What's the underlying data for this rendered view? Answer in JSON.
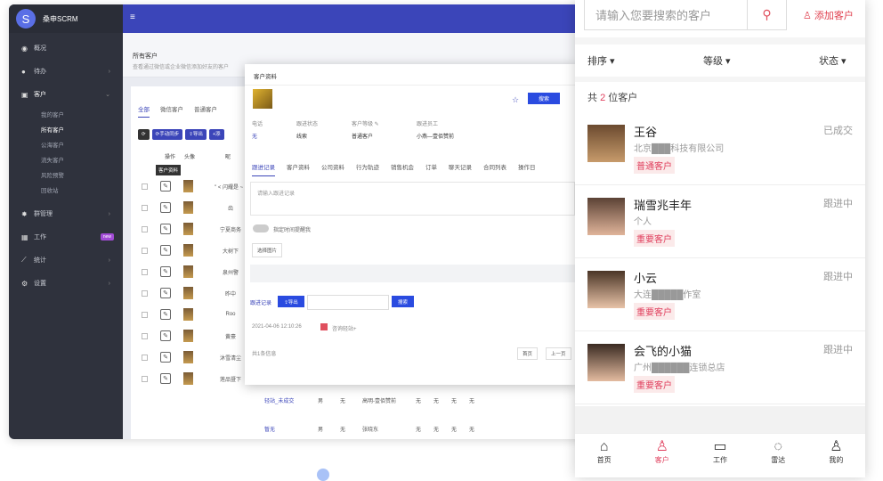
{
  "app": {
    "brand": "桑申SCRM",
    "menu_icon": "≡",
    "logo_glyph": "S"
  },
  "sidebar": {
    "items": [
      {
        "icon": "◉",
        "label": "概况",
        "arrow": ""
      },
      {
        "icon": "●",
        "label": "待办",
        "arrow": "›"
      },
      {
        "icon": "▣",
        "label": "客户",
        "arrow": "⌄"
      },
      {
        "icon": "✸",
        "label": "群管理",
        "arrow": "›"
      },
      {
        "icon": "▦",
        "label": "工作",
        "arrow": "",
        "tag": "new"
      },
      {
        "icon": "⟋",
        "label": "统计",
        "arrow": "›"
      },
      {
        "icon": "⚙",
        "label": "设置",
        "arrow": "›"
      }
    ],
    "sub": [
      "我的客户",
      "所有客户",
      "公海客户",
      "流失客户",
      "风险预警",
      "回收站"
    ]
  },
  "page": {
    "title": "所有客户",
    "desc": "查看通过微信或企业微信添加好友的客户"
  },
  "list": {
    "tabs": [
      "全部",
      "微信客户",
      "普通客户"
    ],
    "buttons": [
      "⟳",
      "⟳手动同步",
      "⇪导出",
      "+添"
    ],
    "headers": [
      "操作",
      "头像",
      "昵"
    ],
    "tooltip": "客户资料",
    "rows": [
      "\" < 闪耀是 ~ \"",
      "齿",
      "宁夏商务",
      "大树下",
      "泉州警",
      "昨中",
      "Roo",
      "黄豪",
      "沐雪清尘",
      "莲品暨下"
    ],
    "last_row": {
      "name": "沐雪清尘",
      "a": "轻站_未成交",
      "b": "男",
      "c": "无",
      "d": "高明-壹佰赞前",
      "e": "无",
      "f": "无",
      "g": "无",
      "h": "无"
    },
    "last_row2": {
      "name": "莲品暨下",
      "a": "暂无",
      "b": "男",
      "c": "无",
      "d": "张晓东",
      "e": "无",
      "f": "无",
      "g": "无",
      "h": "无"
    }
  },
  "modal": {
    "title": "客户资料",
    "star": "☆",
    "search_btn": "搜索",
    "kv": [
      {
        "k": "电话",
        "v": "无"
      },
      {
        "k": "跟进状态",
        "v": "线索"
      },
      {
        "k": "客户等级 ✎",
        "v": "普通客户"
      },
      {
        "k": "跟进员工",
        "v": "小燕—壹佰赞前"
      }
    ],
    "tabs": [
      "跟进记录",
      "客户资料",
      "公司资料",
      "行为轨迹",
      "销售机会",
      "订单",
      "聊天记录",
      "合同列表",
      "操作日"
    ],
    "input_placeholder": "请输入跟进记录",
    "toggle": "指定时间提醒我",
    "pick": "选择图片",
    "follow": "跟进记录",
    "export": "⇪导出",
    "search": "搜索",
    "log_time": "2021-04-06 12:10:26",
    "log_text": "咨询轻站+",
    "total": "共1条信息",
    "pg1": "首页",
    "pg2": "上一页"
  },
  "phone": {
    "search_placeholder": "请输入您要搜索的客户",
    "search_icon": "⚲",
    "add": "♙ 添加客户",
    "filters": [
      "排序 ▾",
      "等级 ▾",
      "状态 ▾"
    ],
    "count_prefix": "共 ",
    "count": "2",
    "count_suffix": " 位客户",
    "customers": [
      {
        "name": "王谷",
        "company": "北京███科技有限公司",
        "level": "普通客户",
        "status": "已成交"
      },
      {
        "name": "瑞雪兆丰年",
        "company": "个人",
        "level": "重要客户",
        "status": "跟进中"
      },
      {
        "name": "小云",
        "company": "大连█████作室",
        "level": "重要客户",
        "status": "跟进中"
      },
      {
        "name": "会飞的小猫",
        "company": "广州██████连锁总店",
        "level": "重要客户",
        "status": "跟进中"
      }
    ],
    "tabbar": [
      {
        "icon": "⌂",
        "label": "首页"
      },
      {
        "icon": "♙",
        "label": "客户"
      },
      {
        "icon": "▭",
        "label": "工作"
      },
      {
        "icon": "◌",
        "label": "雷达"
      },
      {
        "icon": "♙",
        "label": "我的"
      }
    ]
  }
}
